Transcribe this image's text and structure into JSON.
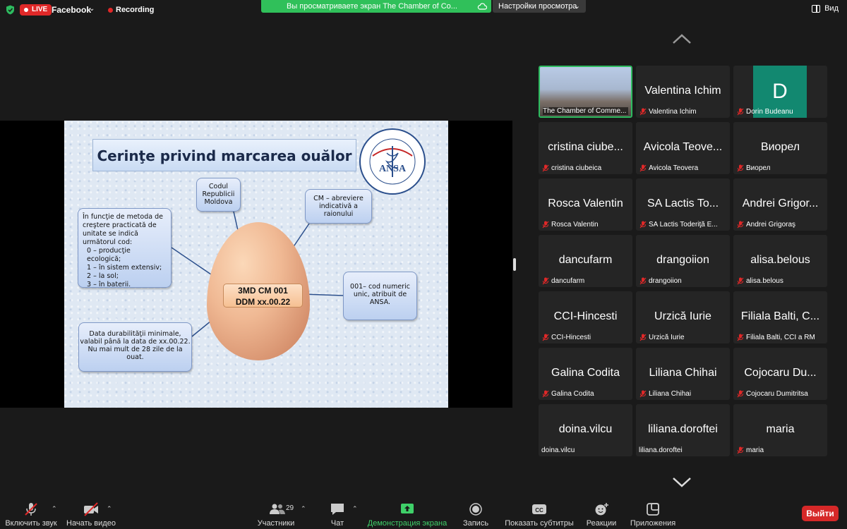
{
  "topbar": {
    "live_label": "LIVE",
    "stream_target": "Facebook",
    "recording_label": "Recording",
    "share_banner": "Вы просматриваете экран The Chamber of Co...",
    "view_options": "Настройки просмотра",
    "view_label": "Вид"
  },
  "slide": {
    "title": "Cerinţe privind marcarea ouălor",
    "egg_code_line1": "3MD CM 001",
    "egg_code_line2": "DDM xx.00.22",
    "callout_left_lines": [
      "În funcţie de metoda de",
      "creştere practicată de",
      "unitate se indică",
      "următorul cod:",
      "  0 – producţie ecologică;",
      "  1 –  în sistem extensiv;",
      "  2 –  la sol;",
      "  3 – în baterii."
    ],
    "callout_codul": [
      "Codul",
      "Republicii",
      "Moldova"
    ],
    "callout_cm": [
      "CM – abreviere",
      "indicativă a",
      "raionului"
    ],
    "callout_001": [
      "001– cod numeric",
      "unic, atribuit de",
      "ANSA."
    ],
    "callout_ddm": [
      "Data durabilităţii minimale,",
      "valabil până la data de xx.00.22.",
      "Nu mai mult de 28 zile de la",
      "ouat."
    ]
  },
  "participants": [
    {
      "display": "",
      "name": "The Chamber of Comme...",
      "type": "video",
      "muted": false
    },
    {
      "display": "Valentina Ichim",
      "name": "Valentina Ichim",
      "type": "name",
      "muted": true
    },
    {
      "display": "D",
      "name": "Dorin Budeanu",
      "type": "avatar",
      "muted": true,
      "avatar_color": "#128870"
    },
    {
      "display": "cristina ciube...",
      "name": "cristina ciubeica",
      "type": "name",
      "muted": true
    },
    {
      "display": "Avicola Teove...",
      "name": "Avicola Teovera",
      "type": "name",
      "muted": true
    },
    {
      "display": "Виорел",
      "name": "Виорел",
      "type": "name",
      "muted": true
    },
    {
      "display": "Rosca Valentin",
      "name": "Rosca Valentin",
      "type": "name",
      "muted": true
    },
    {
      "display": "SA Lactis  To...",
      "name": "SA Lactis  Toderiţă E...",
      "type": "name",
      "muted": true
    },
    {
      "display": "Andrei Grigor...",
      "name": "Andrei Grigoraş",
      "type": "name",
      "muted": true
    },
    {
      "display": "dancufarm",
      "name": "dancufarm",
      "type": "name",
      "muted": true
    },
    {
      "display": "drangoiion",
      "name": "drangoiion",
      "type": "name",
      "muted": true
    },
    {
      "display": "alisa.belous",
      "name": "alisa.belous",
      "type": "name",
      "muted": true
    },
    {
      "display": "CCI-Hincesti",
      "name": "CCI-Hincesti",
      "type": "name",
      "muted": true
    },
    {
      "display": "Urzică Iurie",
      "name": "Urzică Iurie",
      "type": "name",
      "muted": true
    },
    {
      "display": "Filiala Balti, C...",
      "name": "Filiala Balti, CCI a RM",
      "type": "name",
      "muted": true
    },
    {
      "display": "Galina  Codita",
      "name": "Galina  Codita",
      "type": "name",
      "muted": true
    },
    {
      "display": "Liliana Chihai",
      "name": "Liliana Chihai",
      "type": "name",
      "muted": true
    },
    {
      "display": "Cojocaru Du...",
      "name": "Cojocaru Dumitritsa",
      "type": "name",
      "muted": true
    },
    {
      "display": "doina.vilcu",
      "name": "doina.vilcu",
      "type": "name",
      "muted": false
    },
    {
      "display": "liliana.doroftei",
      "name": "liliana.doroftei",
      "type": "name",
      "muted": false
    },
    {
      "display": "maria",
      "name": "maria",
      "type": "name",
      "muted": true
    }
  ],
  "toolbar": {
    "unmute": "Включить звук",
    "start_video": "Начать видео",
    "participants": "Участники",
    "participants_count": "29",
    "chat": "Чат",
    "share_screen": "Демонстрация экрана",
    "record": "Запись",
    "captions": "Показать субтитры",
    "captions_icon_text": "CC",
    "reactions": "Реакции",
    "apps": "Приложения",
    "leave": "Выйти"
  },
  "colors": {
    "accent_green": "#2dbb5f",
    "live_red": "#e02828",
    "leave_red": "#d62828",
    "avatar_teal": "#128870"
  }
}
